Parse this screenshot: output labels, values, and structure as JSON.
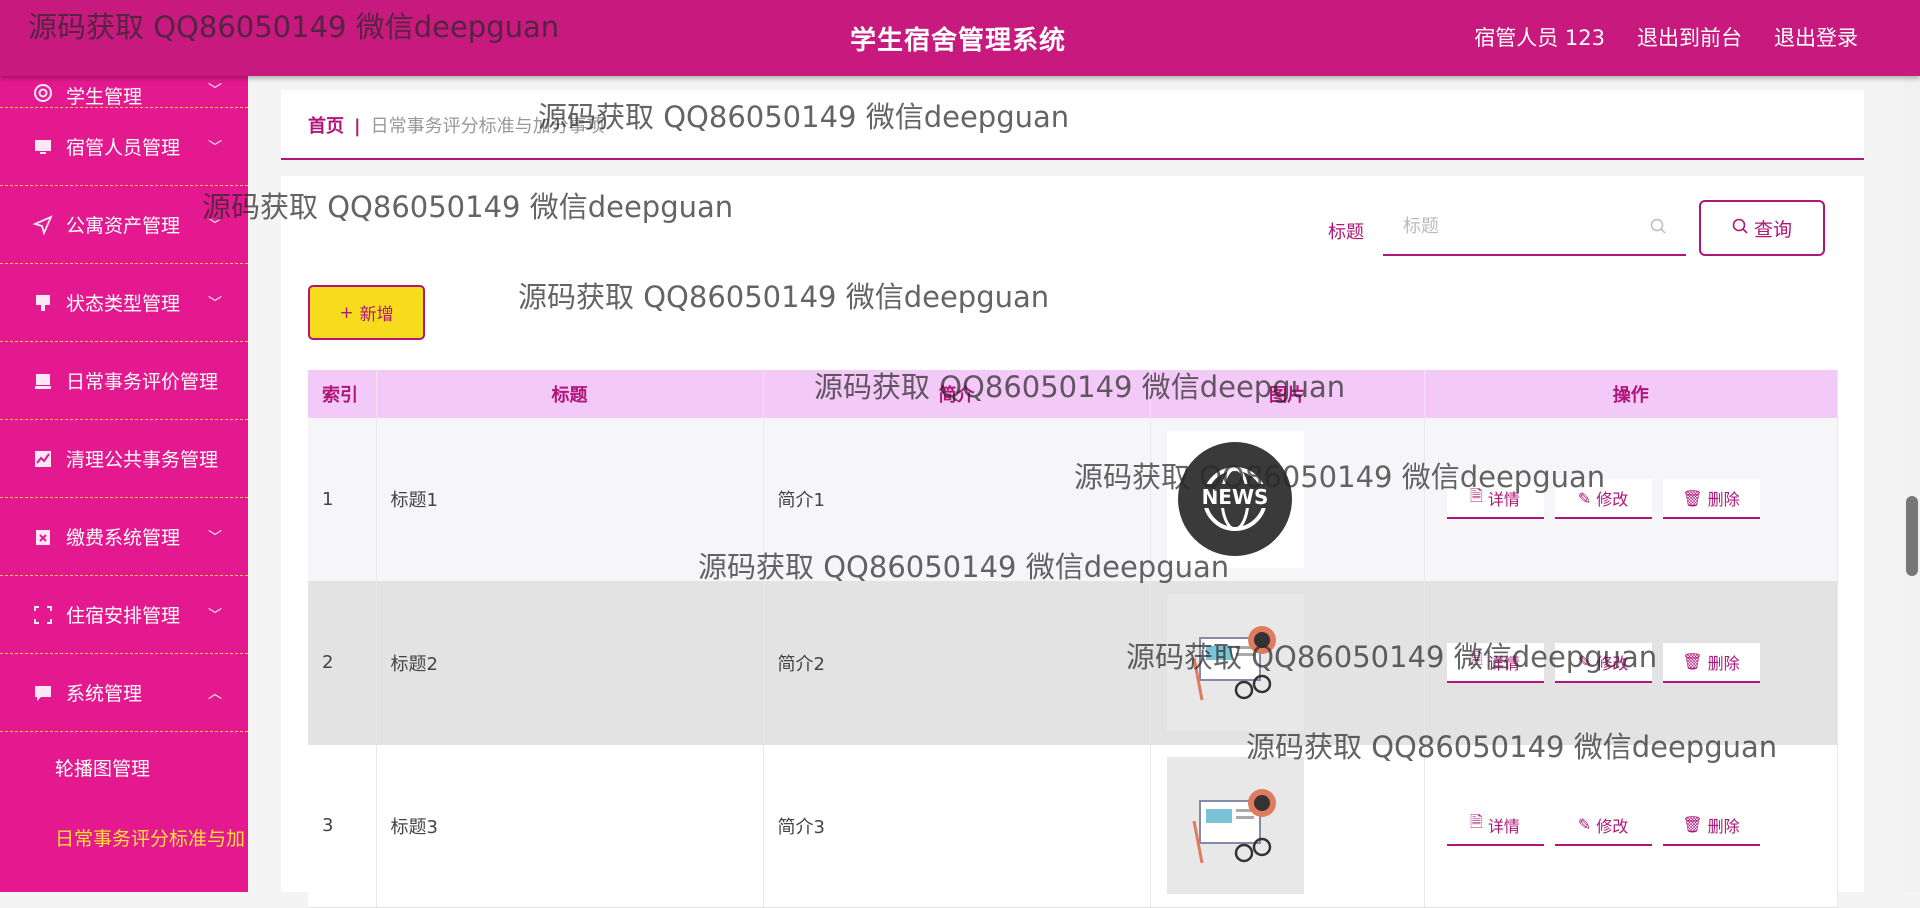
{
  "header": {
    "title": "学生宿舍管理系统",
    "user": "宿管人员 123",
    "to_front": "退出到前台",
    "logout": "退出登录"
  },
  "sidebar": {
    "items": [
      {
        "label": "学生管理",
        "icon": "lifebuoy-icon",
        "chevron": "﹀"
      },
      {
        "label": "宿管人员管理",
        "icon": "monitor-icon",
        "chevron": "﹀"
      },
      {
        "label": "公寓资产管理",
        "icon": "send-icon",
        "chevron": "﹀"
      },
      {
        "label": "状态类型管理",
        "icon": "stamp-icon",
        "chevron": "﹀"
      },
      {
        "label": "日常事务评价管理",
        "icon": "printer-icon",
        "chevron": ""
      },
      {
        "label": "清理公共事务管理",
        "icon": "chart-icon",
        "chevron": ""
      },
      {
        "label": "缴费系统管理",
        "icon": "clipboard-icon",
        "chevron": "﹀"
      },
      {
        "label": "住宿安排管理",
        "icon": "frame-icon",
        "chevron": "﹀"
      },
      {
        "label": "系统管理",
        "icon": "message-icon",
        "chevron": "︿"
      }
    ],
    "sub_items": [
      {
        "label": "轮播图管理"
      },
      {
        "label": "日常事务评分标准与加"
      }
    ]
  },
  "breadcrumb": {
    "home": "首页",
    "sep": "|",
    "current": "日常事务评分标准与加分事项"
  },
  "search": {
    "label": "标题",
    "placeholder": "标题",
    "button": "查询"
  },
  "add_button": "新增",
  "table": {
    "headers": [
      "索引",
      "标题",
      "简介",
      "图片",
      "操作"
    ],
    "rows": [
      {
        "index": "1",
        "title": "标题1",
        "intro": "简介1",
        "image": "news-globe-image"
      },
      {
        "index": "2",
        "title": "标题2",
        "intro": "简介2",
        "image": "news-paper-image"
      },
      {
        "index": "3",
        "title": "标题3",
        "intro": "简介3",
        "image": "news-paper-image"
      }
    ],
    "ops": {
      "detail": "详情",
      "edit": "修改",
      "delete": "删除"
    }
  },
  "watermark": "源码获取 QQ86050149 微信deepguan",
  "colors": {
    "primary": "#c8197f",
    "sidebar": "#e4198f",
    "accent": "#b0157a",
    "add_button": "#f7dc1e",
    "header_row": "#f2c9f7"
  }
}
